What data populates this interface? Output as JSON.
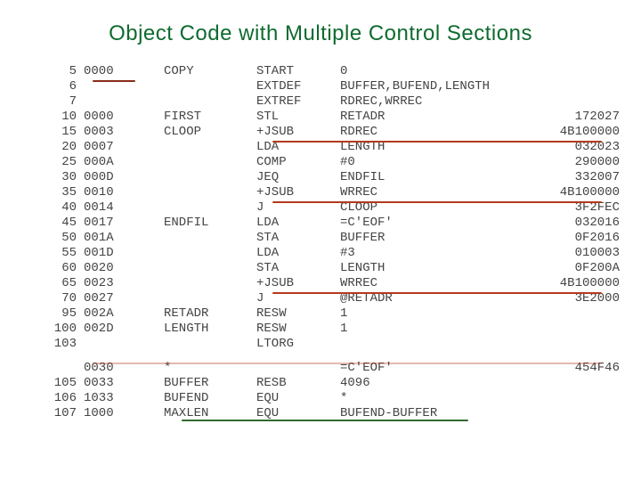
{
  "title": "Object Code with Multiple Control Sections",
  "title_color": "#0e6b2f",
  "rows": [
    {
      "line": "5",
      "addr": "0000",
      "label": "COPY",
      "opcode": "START",
      "operand": "0",
      "obj": ""
    },
    {
      "line": "6",
      "addr": "",
      "label": "",
      "opcode": "EXTDEF",
      "operand": "BUFFER,BUFEND,LENGTH",
      "obj": ""
    },
    {
      "line": "7",
      "addr": "",
      "label": "",
      "opcode": "EXTREF",
      "operand": "RDREC,WRREC",
      "obj": ""
    },
    {
      "line": "10",
      "addr": "0000",
      "label": "FIRST",
      "opcode": "STL",
      "operand": "RETADR",
      "obj": "172027"
    },
    {
      "line": "15",
      "addr": "0003",
      "label": "CLOOP",
      "opcode": "+JSUB",
      "operand": "RDREC",
      "obj": "4B100000"
    },
    {
      "line": "20",
      "addr": "0007",
      "label": "",
      "opcode": "LDA",
      "operand": "LENGTH",
      "obj": "032023"
    },
    {
      "line": "25",
      "addr": "000A",
      "label": "",
      "opcode": "COMP",
      "operand": "#0",
      "obj": "290000"
    },
    {
      "line": "30",
      "addr": "000D",
      "label": "",
      "opcode": "JEQ",
      "operand": "ENDFIL",
      "obj": "332007"
    },
    {
      "line": "35",
      "addr": "0010",
      "label": "",
      "opcode": "+JSUB",
      "operand": "WRREC",
      "obj": "4B100000"
    },
    {
      "line": "40",
      "addr": "0014",
      "label": "",
      "opcode": "J",
      "operand": "CLOOP",
      "obj": "3F2FEC"
    },
    {
      "line": "45",
      "addr": "0017",
      "label": "ENDFIL",
      "opcode": "LDA",
      "operand": "=C'EOF'",
      "obj": "032016"
    },
    {
      "line": "50",
      "addr": "001A",
      "label": "",
      "opcode": "STA",
      "operand": "BUFFER",
      "obj": "0F2016"
    },
    {
      "line": "55",
      "addr": "001D",
      "label": "",
      "opcode": "LDA",
      "operand": "#3",
      "obj": "010003"
    },
    {
      "line": "60",
      "addr": "0020",
      "label": "",
      "opcode": "STA",
      "operand": "LENGTH",
      "obj": "0F200A"
    },
    {
      "line": "65",
      "addr": "0023",
      "label": "",
      "opcode": "+JSUB",
      "operand": "WRREC",
      "obj": "4B100000"
    },
    {
      "line": "70",
      "addr": "0027",
      "label": "",
      "opcode": "J",
      "operand": "@RETADR",
      "obj": "3E2000"
    },
    {
      "line": "95",
      "addr": "002A",
      "label": "RETADR",
      "opcode": "RESW",
      "operand": "1",
      "obj": ""
    },
    {
      "line": "100",
      "addr": "002D",
      "label": "LENGTH",
      "opcode": "RESW",
      "operand": "1",
      "obj": ""
    },
    {
      "line": "103",
      "addr": "",
      "label": "",
      "opcode": "LTORG",
      "operand": "",
      "obj": ""
    },
    {
      "line": "",
      "addr": "0030",
      "label": "*",
      "opcode": "",
      "operand": "=C'EOF'",
      "obj": "454F46"
    },
    {
      "line": "105",
      "addr": "0033",
      "label": "BUFFER",
      "opcode": "RESB",
      "operand": "4096",
      "obj": ""
    },
    {
      "line": "106",
      "addr": "1033",
      "label": "BUFEND",
      "opcode": "EQU",
      "operand": "*",
      "obj": ""
    },
    {
      "line": "107",
      "addr": "1000",
      "label": "MAXLEN",
      "opcode": "EQU",
      "operand": "BUFEND-BUFFER",
      "obj": ""
    }
  ]
}
